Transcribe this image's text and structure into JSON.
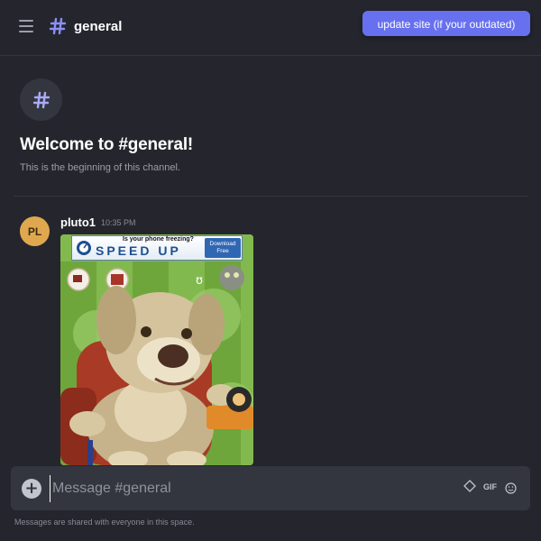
{
  "header": {
    "channel_name": "general",
    "update_button_label": "update site (if your outdated)"
  },
  "welcome": {
    "title": "Welcome to #general!",
    "subtitle": "This is the beginning of this channel."
  },
  "messages": [
    {
      "avatar_initials": "PL",
      "author": "pluto1",
      "time": "10:35 PM",
      "attachment": {
        "ad_top_text": "Is your phone freezing?",
        "ad_main_text": "SPEED UP",
        "ad_button_text": "Download Free"
      }
    }
  ],
  "composer": {
    "placeholder": "Message #general",
    "gif_label": "GIF"
  },
  "footer": {
    "note": "Messages are shared with everyone in this space."
  },
  "colors": {
    "background": "#25262d",
    "accent": "#6770ef",
    "avatar": "#e0a84e",
    "composer": "#34363f"
  },
  "icons": {
    "menu": "menu-icon",
    "hash": "hash-icon",
    "plus": "plus-icon",
    "sticker": "sticker-icon",
    "emoji": "emoji-icon"
  }
}
